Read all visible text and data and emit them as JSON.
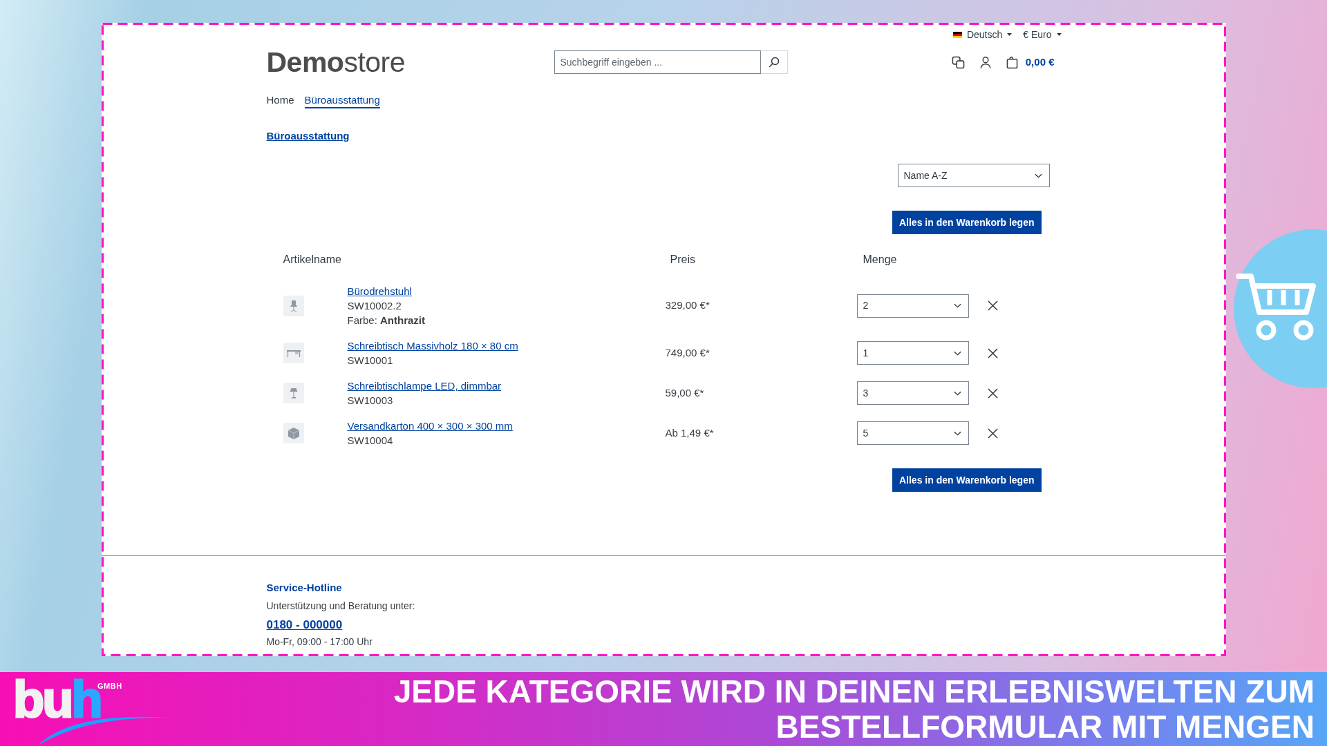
{
  "top_bar": {
    "language": "Deutsch",
    "currency": "€ Euro"
  },
  "header": {
    "logo": "**Demo**store",
    "search": {
      "placeholder": "Suchbegriff eingeben ..."
    },
    "cart_total": "0,00 €"
  },
  "nav": [
    {
      "label": "Home",
      "selected": false
    },
    {
      "label": "Büroausstattung",
      "selected": true
    }
  ],
  "category_title": "Büroausstattung",
  "order_form": {
    "sort": "Name A-Z",
    "add_all_top": "Alles in den Warenkorb legen",
    "columns": [
      "Artikelname",
      "Preis",
      "Menge"
    ],
    "rows": [
      {
        "name": "Bürodrehstuhl",
        "sku": "SW10002.2",
        "option": "Farbe: **Anthrazit**",
        "price": "329,00 €*",
        "quantity": "2"
      },
      {
        "name": "Schreibtisch Massivholz 180 × 80 cm",
        "sku": "SW10001",
        "price": "749,00 €*",
        "quantity": "1"
      },
      {
        "name": "Schreibtischlampe LED, dimmbar",
        "sku": "SW10003",
        "price": "59,00 €*",
        "quantity": "3"
      },
      {
        "name": "Versandkarton 400 × 300 × 300 mm",
        "sku": "SW10004",
        "price": "Ab 1,49 €*",
        "quantity": "5"
      }
    ],
    "add_all_bottom": "Alles in den Warenkorb legen"
  },
  "footer": {
    "title": "Service-Hotline",
    "text": "Unterstützung und Beratung unter:",
    "phone": "0180 - 000000",
    "hours": "Mo-Fr, 09:00 - 17:00 Uhr"
  },
  "banner": {
    "logo": {
      "text": "bu",
      "accent": "h",
      "suffix": "GMBH"
    },
    "caption_lines": [
      "JEDE KATEGORIE WIRD IN DEINEN ERLEBNISWELTEN ZUM",
      "BESTELLFORMULAR MIT MENGEN"
    ]
  }
}
